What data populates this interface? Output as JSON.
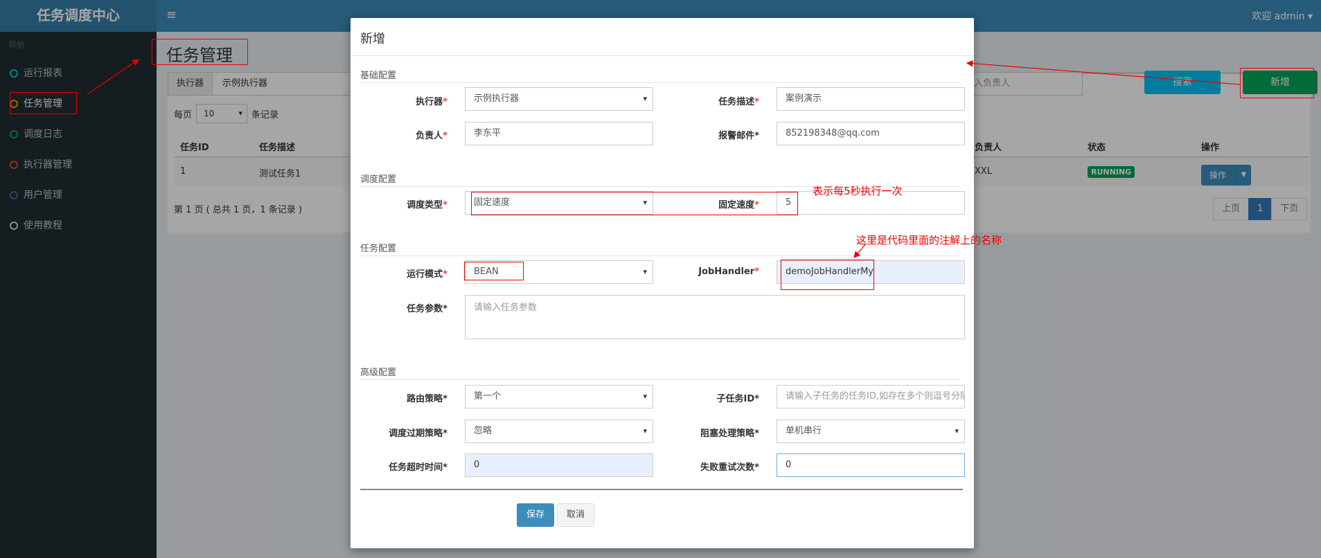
{
  "app": {
    "logo": "任务调度中心",
    "menu_icon": "≡",
    "welcome": "欢迎 admin ▾"
  },
  "sidebar": {
    "header": "导航",
    "items": [
      {
        "label": "运行报表",
        "color": "#00c0ef"
      },
      {
        "label": "任务管理",
        "color": "#f39c12"
      },
      {
        "label": "调度日志",
        "color": "#00a65a"
      },
      {
        "label": "执行器管理",
        "color": "#dd4b39"
      },
      {
        "label": "用户管理",
        "color": "#605ca8"
      },
      {
        "label": "使用教程",
        "color": "#d2d6de"
      }
    ]
  },
  "page": {
    "title": "任务管理",
    "filter_addon": "执行器",
    "filter_value": "示例执行器",
    "owner_placeholder": "入负责人",
    "search_button": "搜索",
    "add_button": "新增",
    "per_page_prefix": "每页",
    "per_page_value": "10",
    "per_page_suffix": "条记录",
    "table": {
      "headers": {
        "id": "任务ID",
        "desc": "任务描述",
        "owner": "负责人",
        "status": "状态",
        "op": "操作"
      },
      "row": {
        "id": "1",
        "desc": "测试任务1",
        "owner": "XXL",
        "status": "RUNNING",
        "op": "操作"
      }
    },
    "page_info": "第 1 页 ( 总共 1 页，1 条记录 )",
    "pager": {
      "prev": "上页",
      "current": "1",
      "next": "下页"
    }
  },
  "modal": {
    "title": "新增",
    "sections": {
      "basic": "基础配置",
      "schedule": "调度配置",
      "task": "任务配置",
      "advanced": "高级配置"
    },
    "fields": {
      "executor": {
        "label": "执行器",
        "value": "示例执行器"
      },
      "job_desc": {
        "label": "任务描述",
        "value": "案例演示"
      },
      "author": {
        "label": "负责人",
        "value": "李东平"
      },
      "alarm_email": {
        "label": "报警邮件",
        "value": "852198348@qq.com"
      },
      "schedule_type": {
        "label": "调度类型",
        "value": "固定速度"
      },
      "fix_rate": {
        "label": "固定速度",
        "value": "5"
      },
      "glue_type": {
        "label": "运行模式",
        "value": "BEAN"
      },
      "job_handler": {
        "label": "JobHandler",
        "value": "demoJobHandlerMy"
      },
      "job_param": {
        "label": "任务参数",
        "placeholder": "请输入任务参数"
      },
      "route": {
        "label": "路由策略",
        "value": "第一个"
      },
      "child_job": {
        "label": "子任务ID",
        "placeholder": "请输入子任务的任务ID,如存在多个则逗号分隔"
      },
      "misfire": {
        "label": "调度过期策略",
        "value": "忽略"
      },
      "block": {
        "label": "阻塞处理策略",
        "value": "单机串行"
      },
      "timeout": {
        "label": "任务超时时间",
        "value": "0"
      },
      "fail_retry": {
        "label": "失败重试次数",
        "value": "0"
      }
    },
    "save_button": "保存",
    "cancel_button": "取消"
  },
  "annotations": {
    "rate_note": "表示每5秒执行一次",
    "handler_note": "这里是代码里面的注解上的名称"
  }
}
